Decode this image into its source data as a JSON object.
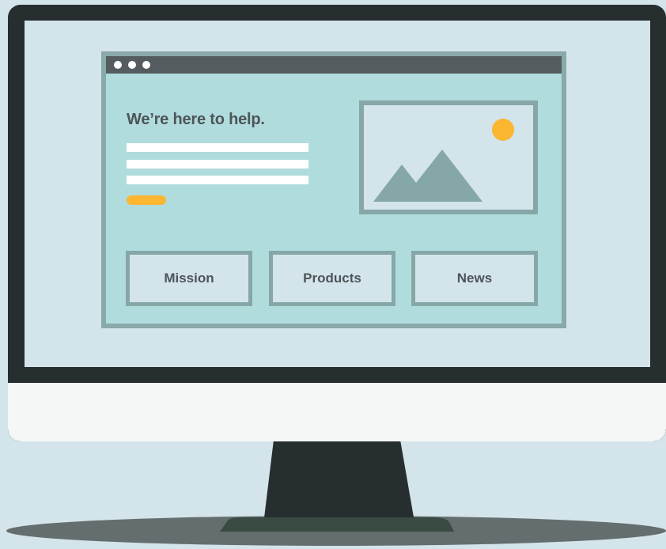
{
  "hero": {
    "headline": "We’re here to help.",
    "image_icon": "landscape-image-icon"
  },
  "browser": {
    "window_controls": [
      "dot",
      "dot",
      "dot"
    ]
  },
  "nav": {
    "items": [
      {
        "label": "Mission"
      },
      {
        "label": "Products"
      },
      {
        "label": "News"
      }
    ]
  },
  "colors": {
    "background": "#d3e4ea",
    "bezel": "#262e30",
    "chin": "#f5f6f6",
    "titlebar": "#555c5f",
    "content": "#b1dcdd",
    "frame": "#86a7a7",
    "accent": "#fbb632",
    "text": "#4d5558",
    "stand_shadow": "#656e6e"
  }
}
